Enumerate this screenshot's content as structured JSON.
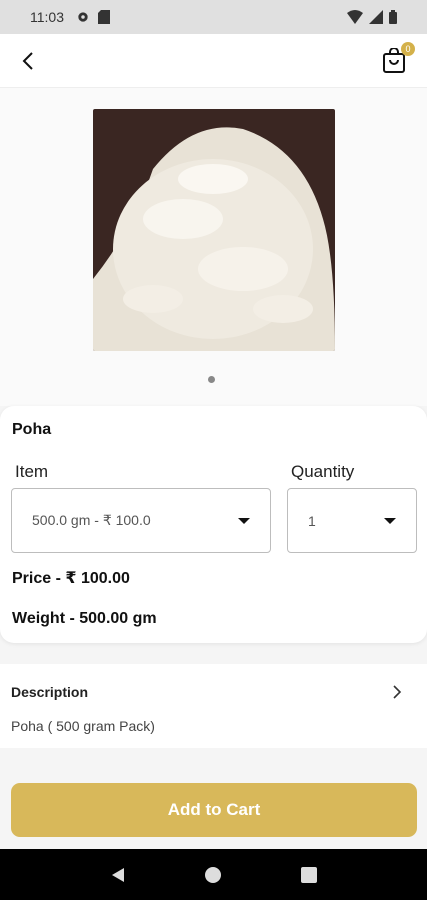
{
  "status_bar": {
    "time": "11:03",
    "icons": [
      "settings-icon",
      "sim-card-icon",
      "wifi-icon",
      "signal-icon",
      "battery-icon"
    ]
  },
  "app_bar": {
    "back_icon": "back-arrow-icon",
    "cart_icon": "shopping-bag-icon",
    "cart_count": "0"
  },
  "product": {
    "image_alt": "product-image",
    "name": "Poha",
    "item_label": "Item",
    "quantity_label": "Quantity",
    "item_selected": "500.0 gm - ₹ 100.0",
    "quantity_selected": "1",
    "price": "Price - ₹ 100.00",
    "weight": "Weight - 500.00 gm"
  },
  "description": {
    "title": "Description",
    "text": "Poha ( 500 gram Pack)"
  },
  "actions": {
    "add_to_cart": "Add to Cart"
  },
  "colors": {
    "accent": "#d8b85a",
    "badge": "#d4b14a"
  },
  "nav_bar": {
    "icons": [
      "nav-back-icon",
      "nav-home-icon",
      "nav-recents-icon"
    ]
  }
}
